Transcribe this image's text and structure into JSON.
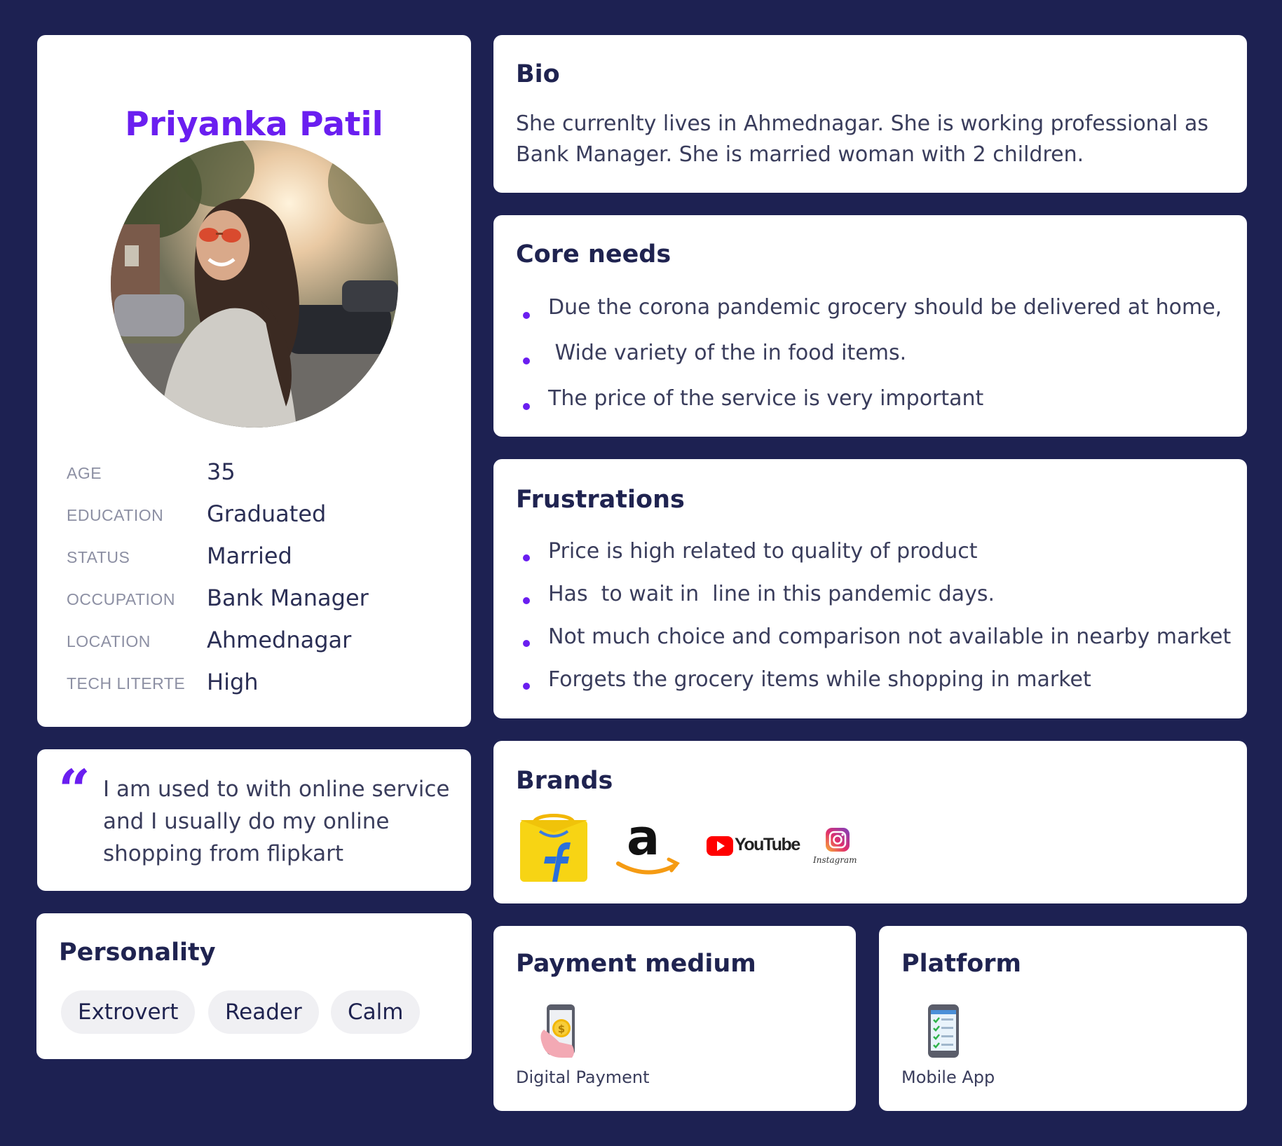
{
  "profile": {
    "name": "Priyanka Patil",
    "facts": [
      {
        "label": "AGE",
        "value": "35"
      },
      {
        "label": "EDUCATION",
        "value": "Graduated"
      },
      {
        "label": "STATUS",
        "value": "Married"
      },
      {
        "label": "OCCUPATION",
        "value": "Bank Manager"
      },
      {
        "label": "LOCATION",
        "value": "Ahmednagar"
      },
      {
        "label": "TECH  LITERTE",
        "value": "High"
      }
    ]
  },
  "quote": {
    "mark": "“",
    "text": "I am used to with online service and I usually do my online shopping from flipkart"
  },
  "personality": {
    "title": "Personality",
    "tags": [
      "Extrovert",
      "Reader",
      "Calm"
    ]
  },
  "bio": {
    "title": "Bio",
    "text": "She currenlty lives in Ahmednagar. She is working professional as Bank Manager. She is married woman with 2 children."
  },
  "core_needs": {
    "title": "Core needs",
    "items": [
      "Due the corona pandemic grocery should be delivered at home,",
      " Wide variety of the in food items.",
      "The price of the service is very important"
    ]
  },
  "frustrations": {
    "title": "Frustrations",
    "items": [
      "Price is high related to quality of product",
      "Has  to wait in  line in this pandemic days.",
      "Not much choice and comparison not available in nearby market",
      "Forgets the grocery items while shopping in market"
    ]
  },
  "brands": {
    "title": "Brands",
    "logos": [
      {
        "icon": "flipkart-logo-icon"
      },
      {
        "icon": "amazon-logo-icon",
        "text": "a"
      },
      {
        "icon": "youtube-logo-icon",
        "text": "YouTube"
      },
      {
        "icon": "instagram-logo-icon",
        "text": "Instagram"
      }
    ]
  },
  "payment": {
    "title": "Payment medium",
    "label": "Digital Payment",
    "icon": "phone-payment-icon"
  },
  "platform": {
    "title": "Platform",
    "label": "Mobile App",
    "icon": "mobile-app-icon"
  },
  "colors": {
    "background": "#1d2152",
    "accent": "#6a1ef0",
    "card": "#ffffff",
    "heading": "#1f2350"
  }
}
